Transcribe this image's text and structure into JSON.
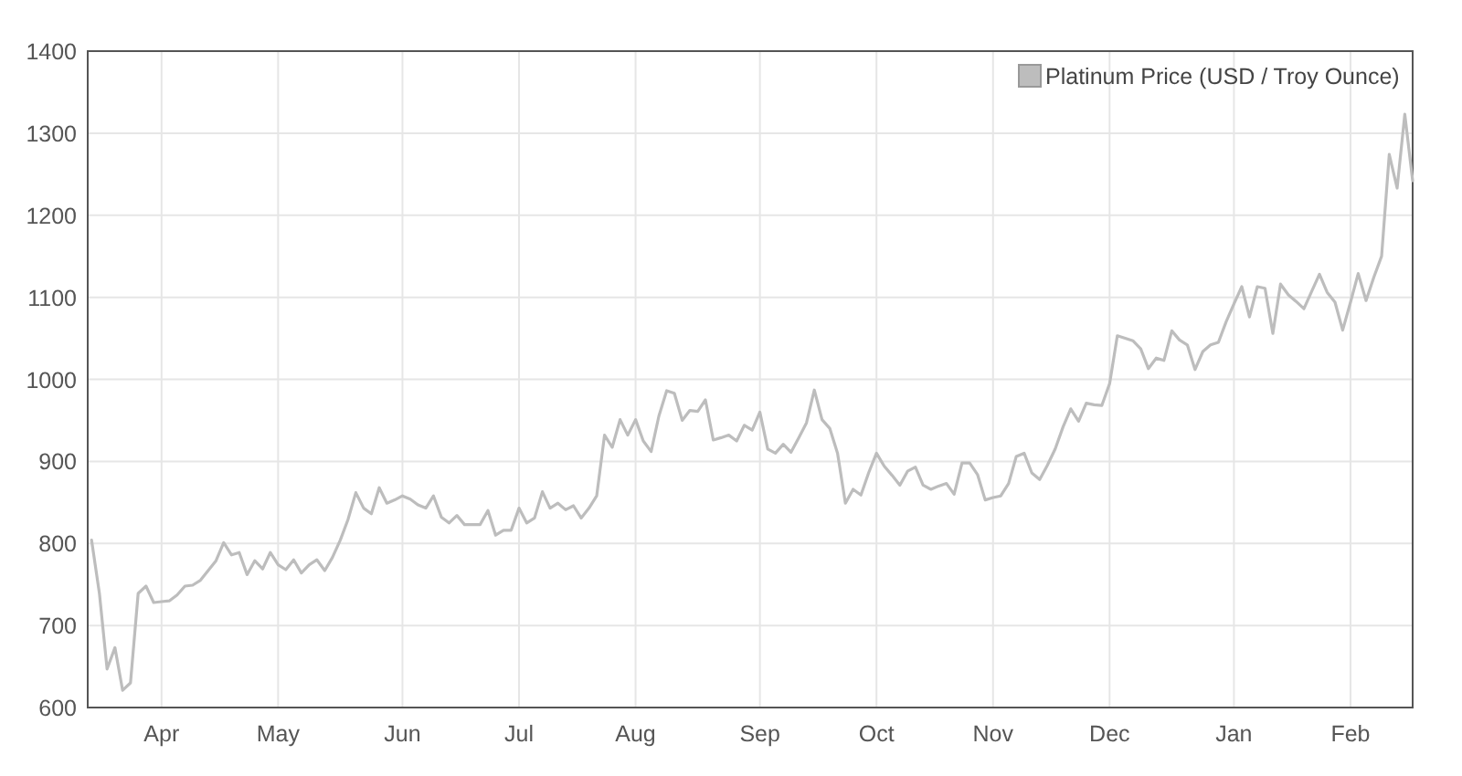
{
  "chart": {
    "chart_data": {
      "type": "line",
      "categories": [
        null,
        null,
        null,
        null,
        null,
        null,
        null,
        null,
        null,
        "Apr",
        null,
        null,
        null,
        null,
        null,
        null,
        null,
        null,
        null,
        null,
        null,
        null,
        null,
        null,
        "May",
        null,
        null,
        null,
        null,
        null,
        null,
        null,
        null,
        null,
        null,
        null,
        null,
        null,
        null,
        null,
        "Jun",
        null,
        null,
        null,
        null,
        null,
        null,
        null,
        null,
        null,
        null,
        null,
        null,
        null,
        null,
        "Jul",
        null,
        null,
        null,
        null,
        null,
        null,
        null,
        null,
        null,
        null,
        null,
        null,
        null,
        null,
        "Aug",
        null,
        null,
        null,
        null,
        null,
        null,
        null,
        null,
        null,
        null,
        null,
        null,
        null,
        null,
        null,
        "Sep",
        null,
        null,
        null,
        null,
        null,
        null,
        null,
        null,
        null,
        null,
        null,
        null,
        null,
        null,
        "Oct",
        null,
        null,
        null,
        null,
        null,
        null,
        null,
        null,
        null,
        null,
        null,
        null,
        null,
        null,
        "Nov",
        null,
        null,
        null,
        null,
        null,
        null,
        null,
        null,
        null,
        null,
        null,
        null,
        null,
        null,
        "Dec",
        null,
        null,
        null,
        null,
        null,
        null,
        null,
        null,
        null,
        null,
        null,
        null,
        null,
        null,
        null,
        "Jan",
        null,
        null,
        null,
        null,
        null,
        null,
        null,
        null,
        null,
        null,
        null,
        null,
        null,
        null,
        "Feb",
        null,
        null,
        null,
        null,
        null,
        null,
        null,
        null
      ],
      "series": [
        {
          "name": "Platinum Price (USD / Troy Ounce)",
          "color": "#bdbdbd",
          "values": [
            804,
            739,
            647,
            673,
            621,
            630,
            739,
            748,
            728,
            729,
            730,
            737,
            748,
            749,
            755,
            767,
            779,
            801,
            786,
            789,
            762,
            779,
            769,
            789,
            774,
            768,
            780,
            764,
            774,
            780,
            767,
            783,
            804,
            829,
            862,
            843,
            836,
            868,
            849,
            853,
            858,
            854,
            847,
            843,
            858,
            832,
            825,
            834,
            823,
            823,
            823,
            840,
            810,
            816,
            816,
            843,
            825,
            831,
            863,
            843,
            849,
            841,
            846,
            831,
            843,
            858,
            932,
            917,
            951,
            932,
            951,
            925,
            912,
            955,
            986,
            983,
            950,
            962,
            961,
            975,
            926,
            929,
            932,
            925,
            944,
            938,
            960,
            915,
            910,
            921,
            911,
            929,
            947,
            987,
            951,
            940,
            910,
            849,
            866,
            859,
            886,
            910,
            894,
            883,
            871,
            888,
            893,
            871,
            866,
            870,
            873,
            860,
            898,
            898,
            884,
            853,
            856,
            858,
            873,
            906,
            910,
            886,
            878,
            895,
            915,
            942,
            964,
            949,
            971,
            969,
            968,
            995,
            1053,
            1050,
            1047,
            1037,
            1013,
            1026,
            1023,
            1059,
            1048,
            1042,
            1012,
            1034,
            1042,
            1045,
            1070,
            1092,
            1113,
            1076,
            1113,
            1111,
            1056,
            1116,
            1103,
            1095,
            1086,
            1107,
            1128,
            1106,
            1094,
            1060,
            1094,
            1129,
            1096,
            1124,
            1150,
            1274,
            1233,
            1323,
            1242
          ]
        }
      ],
      "grid": true,
      "ylim": [
        600,
        1400
      ],
      "yticks": [
        600,
        700,
        800,
        900,
        1000,
        1100,
        1200,
        1300,
        1400
      ]
    }
  }
}
